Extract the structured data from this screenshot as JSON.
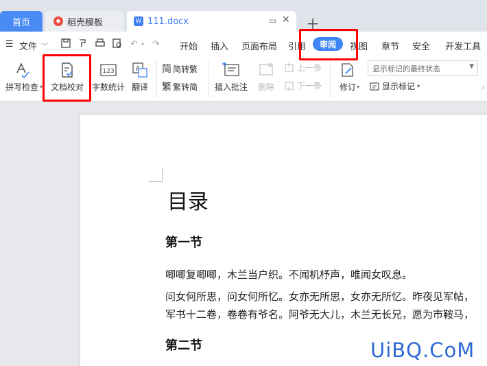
{
  "tabs": {
    "home": "首页",
    "template": "稻壳模板",
    "document": "111.docx",
    "doc_icon_letter": "W"
  },
  "menu": {
    "file": "文件",
    "items": [
      "开始",
      "插入",
      "页面布局",
      "引用",
      "审阅",
      "视图",
      "章节",
      "安全",
      "开发工具"
    ],
    "active": "审阅"
  },
  "ribbon": {
    "spell_check": "拼写检查",
    "doc_proofread": "文档校对",
    "word_count": "字数统计",
    "translate": "翻译",
    "to_traditional": "简转繁",
    "to_simplified": "繁转简",
    "insert_comment": "插入批注",
    "delete": "删除",
    "previous": "上一条",
    "next": "下一条",
    "track_changes": "修订",
    "markup_state": "显示标记的最终状态",
    "show_markup": "显示标记"
  },
  "document": {
    "title": "目录",
    "section1": "第一节",
    "para1": "唧唧复唧唧，木兰当户织。不闻机杼声，唯闻女叹息。",
    "para2": "问女何所思，问女何所忆。女亦无所思，女亦无所忆。昨夜见军帖，",
    "para3": "军书十二卷，卷卷有爷名。阿爷无大儿，木兰无长兄，愿为市鞍马，",
    "section2": "第二节"
  },
  "watermark": "UiBQ.CoM",
  "colors": {
    "accent": "#3e86f5",
    "highlight": "#ff0000",
    "template_icon": "#e94b3c"
  }
}
